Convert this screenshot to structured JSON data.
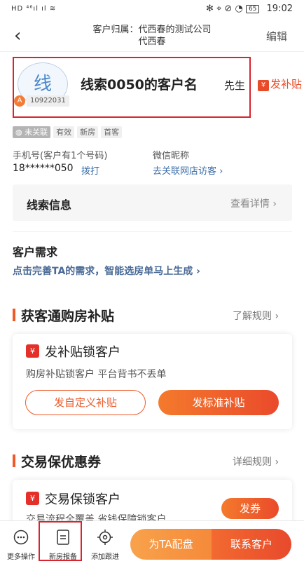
{
  "status_bar": {
    "left": "HD ⁴⁶ıl ıl ≋",
    "right_icons": "✻ ⌖ ⊘ ◔",
    "battery": "65",
    "time": "19:02"
  },
  "header": {
    "title_line1": "客户归属：代西春的测试公司",
    "title_line2": "代西春",
    "edit_label": "编辑"
  },
  "customer": {
    "avatar_char": "线",
    "level_badge": "A",
    "id": "10922031",
    "name": "线索0050的客户名",
    "suffix": "先生",
    "subsidy_button": "发补贴"
  },
  "tags": [
    "未关联",
    "有效",
    "新房",
    "首客"
  ],
  "contact": {
    "phone_label": "手机号(客户有1个号码)",
    "phone_value": "18******050",
    "call_label": "拨打",
    "wechat_label": "微信昵称",
    "wechat_link": "去关联网店访客"
  },
  "lead_info": {
    "title": "线索信息",
    "link": "查看详情"
  },
  "demand": {
    "title": "客户需求",
    "link": "点击完善TA的需求，智能选房单马上生成"
  },
  "subsidy_section": {
    "title": "获客通购房补贴",
    "more": "了解规则",
    "card_title": "发补贴锁客户",
    "card_icon": "¥",
    "card_desc": "购房补贴锁客户  平台背书不丢单",
    "btn_custom": "发自定义补贴",
    "btn_standard": "发标准补贴"
  },
  "coupon_section": {
    "title": "交易保优惠券",
    "more": "详细规则",
    "card_title": "交易保锁客户",
    "card_icon": "¥",
    "card_desc": "交易流程全覆盖 省钱保障锁客户",
    "btn": "发券"
  },
  "bottom_bar": {
    "more_label": "更多操作",
    "report_label": "新房报备",
    "follow_label": "添加跟进",
    "match_label": "为TA配盘",
    "contact_label": "联系客户"
  },
  "colors": {
    "accent": "#ea4a2b",
    "highlight_border": "#d9232e",
    "link": "#3c6ea8"
  }
}
